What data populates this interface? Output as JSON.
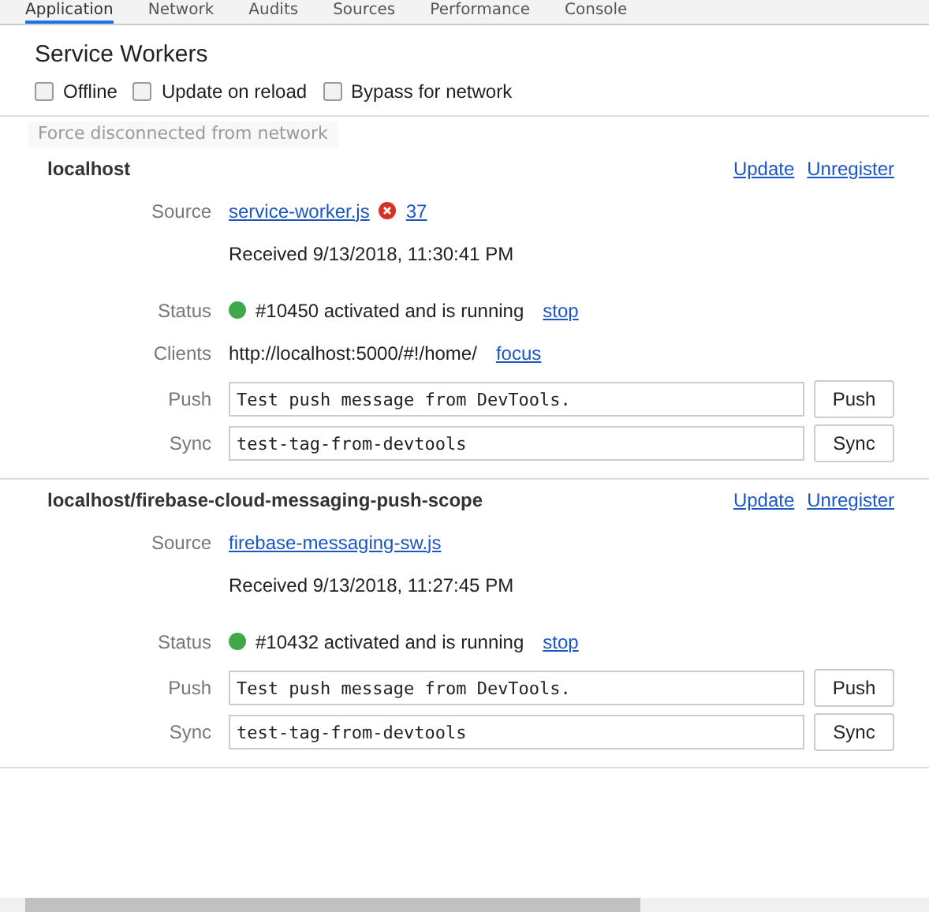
{
  "tabs": [
    {
      "label": "Application",
      "selected": true
    },
    {
      "label": "Network",
      "selected": false
    },
    {
      "label": "Audits",
      "selected": false
    },
    {
      "label": "Sources",
      "selected": false
    },
    {
      "label": "Performance",
      "selected": false
    },
    {
      "label": "Console",
      "selected": false
    }
  ],
  "title": "Service Workers",
  "options": [
    {
      "label": "Offline",
      "checked": false
    },
    {
      "label": "Update on reload",
      "checked": false
    },
    {
      "label": "Bypass for network",
      "checked": false
    }
  ],
  "tooltip": "Force disconnected from network",
  "workers": [
    {
      "scope": "localhost",
      "actions": [
        "Update",
        "Unregister"
      ],
      "source_label": "Source",
      "source": "service-worker.js",
      "errors": "37",
      "received": "Received 9/13/2018, 11:30:41 PM",
      "status_label": "Status",
      "status": "#10450 activated and is running",
      "running": true,
      "status_action": "stop",
      "clients_label": "Clients",
      "clients": "http://localhost:5000/#!/home/",
      "clients_action": "focus",
      "push_label": "Push",
      "push_value": "Test push message from DevTools.",
      "push_button": "Push",
      "sync_label": "Sync",
      "sync_value": "test-tag-from-devtools",
      "sync_button": "Sync"
    },
    {
      "scope": "localhost/firebase-cloud-messaging-push-scope",
      "actions": [
        "Update",
        "Unregister"
      ],
      "source_label": "Source",
      "source": "firebase-messaging-sw.js",
      "received": "Received 9/13/2018, 11:27:45 PM",
      "status_label": "Status",
      "status": "#10432 activated and is running",
      "running": true,
      "status_action": "stop",
      "push_label": "Push",
      "push_value": "Test push message from DevTools.",
      "push_button": "Push",
      "sync_label": "Sync",
      "sync_value": "test-tag-from-devtools",
      "sync_button": "Sync"
    }
  ]
}
